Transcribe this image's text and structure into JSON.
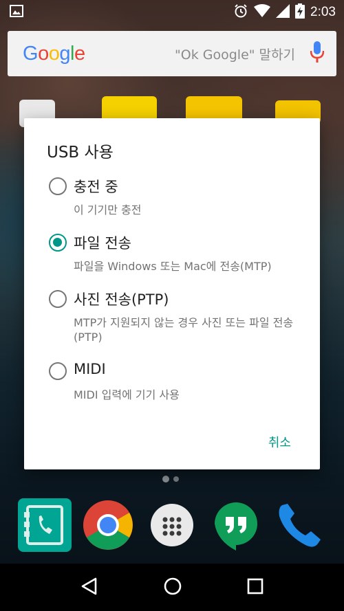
{
  "status_bar": {
    "time": "2:03"
  },
  "search": {
    "logo": "Google",
    "hint": "\"Ok Google\" 말하기"
  },
  "dialog": {
    "title": "USB 사용",
    "options": [
      {
        "label": "충전 중",
        "desc": "이 기기만 충전",
        "checked": false
      },
      {
        "label": "파일 전송",
        "desc": "파일을 Windows 또는 Mac에 전송(MTP)",
        "checked": true
      },
      {
        "label": "사진 전송(PTP)",
        "desc": "MTP가 지원되지 않는 경우 사진 또는 파일 전송(PTP)",
        "checked": false
      },
      {
        "label": "MIDI",
        "desc": "MIDI 입력에 기기 사용",
        "checked": false
      }
    ],
    "cancel_label": "취소"
  },
  "colors": {
    "accent": "#009688",
    "scrim": "#000000"
  },
  "dock": {
    "apps": [
      "phone-dialer-app",
      "chrome",
      "app-drawer",
      "hangouts",
      "phone"
    ]
  },
  "nav": {
    "buttons": [
      "back",
      "home",
      "recents"
    ]
  }
}
